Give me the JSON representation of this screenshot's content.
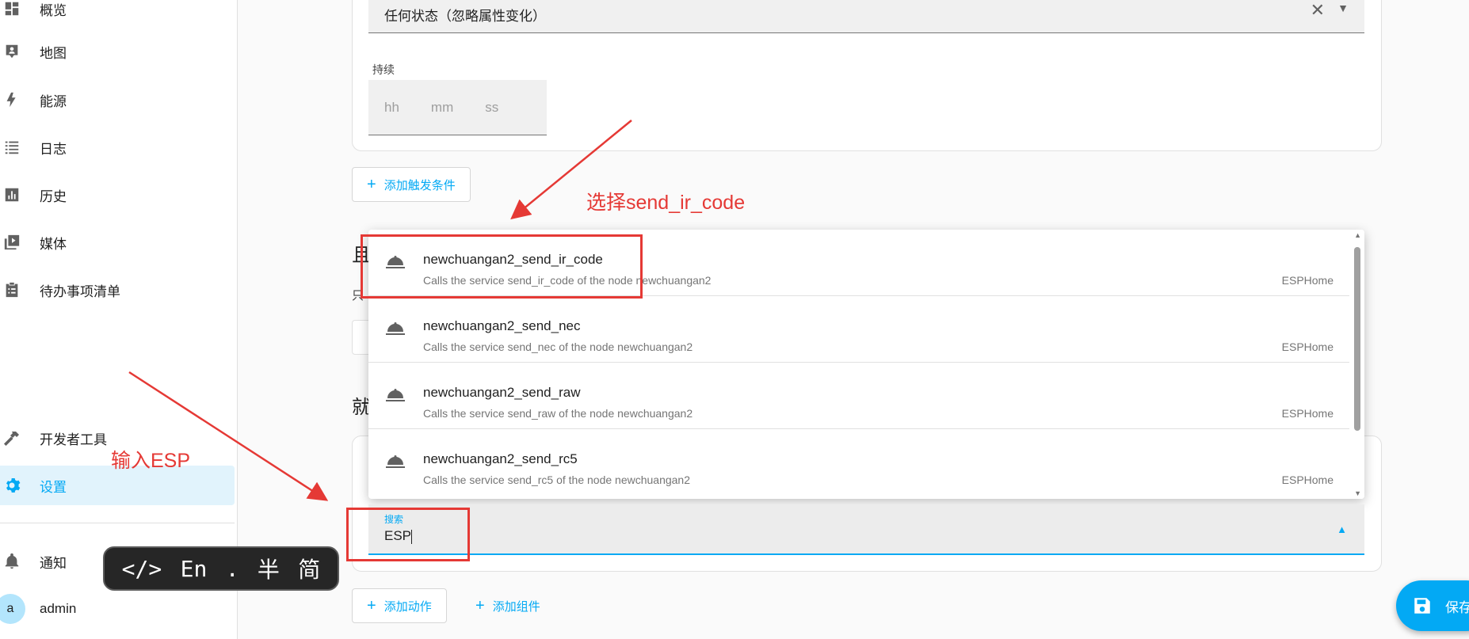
{
  "sidebar": {
    "items": [
      {
        "label": "概览",
        "icon": "dashboard-icon"
      },
      {
        "label": "地图",
        "icon": "map-icon"
      },
      {
        "label": "能源",
        "icon": "lightning-bolt-icon"
      },
      {
        "label": "日志",
        "icon": "list-icon"
      },
      {
        "label": "历史",
        "icon": "chart-bar-icon"
      },
      {
        "label": "媒体",
        "icon": "media-play-icon"
      },
      {
        "label": "待办事项清单",
        "icon": "clipboard-list-icon"
      },
      {
        "label": "开发者工具",
        "icon": "hammer-icon"
      },
      {
        "label": "设置",
        "icon": "gear-icon"
      },
      {
        "label": "通知",
        "icon": "bell-icon"
      },
      {
        "label": "admin",
        "icon": "avatar"
      }
    ],
    "avatar_letter": "a",
    "active_color": "#03a9f4"
  },
  "trigger": {
    "state_value": "任何状态（忽略属性变化）",
    "duration_label": "持续",
    "duration_placeholders": [
      "hh",
      "mm",
      "ss"
    ],
    "add_trigger_label": "添加触发条件"
  },
  "conditions": {
    "heading_fragment": "且",
    "sub_fragment": "只"
  },
  "actions": {
    "heading_fragment": "就",
    "add_action_label": "添加动作",
    "add_block_label": "添加组件"
  },
  "dropdown": {
    "options": [
      {
        "title": "newchuangan2_send_ir_code",
        "desc": "Calls the service send_ir_code of the node newchuangan2",
        "source": "ESPHome",
        "icon": "service-bell-icon"
      },
      {
        "title": "newchuangan2_send_nec",
        "desc": "Calls the service send_nec of the node newchuangan2",
        "source": "ESPHome",
        "icon": "service-bell-icon"
      },
      {
        "title": "newchuangan2_send_raw",
        "desc": "Calls the service send_raw of the node newchuangan2",
        "source": "ESPHome",
        "icon": "service-bell-icon"
      },
      {
        "title": "newchuangan2_send_rc5",
        "desc": "Calls the service send_rc5 of the node newchuangan2",
        "source": "ESPHome",
        "icon": "service-bell-icon"
      }
    ]
  },
  "search": {
    "label": "搜索",
    "value": "ESP"
  },
  "annotations": {
    "select_hint": "选择send_ir_code",
    "input_hint": "输入ESP",
    "color": "#e53935"
  },
  "ime": {
    "code_symbol": "</>",
    "lang": "En",
    "punct": ".",
    "width_mode": "半",
    "script_mode": "简"
  },
  "save_button": {
    "label": "保存"
  }
}
